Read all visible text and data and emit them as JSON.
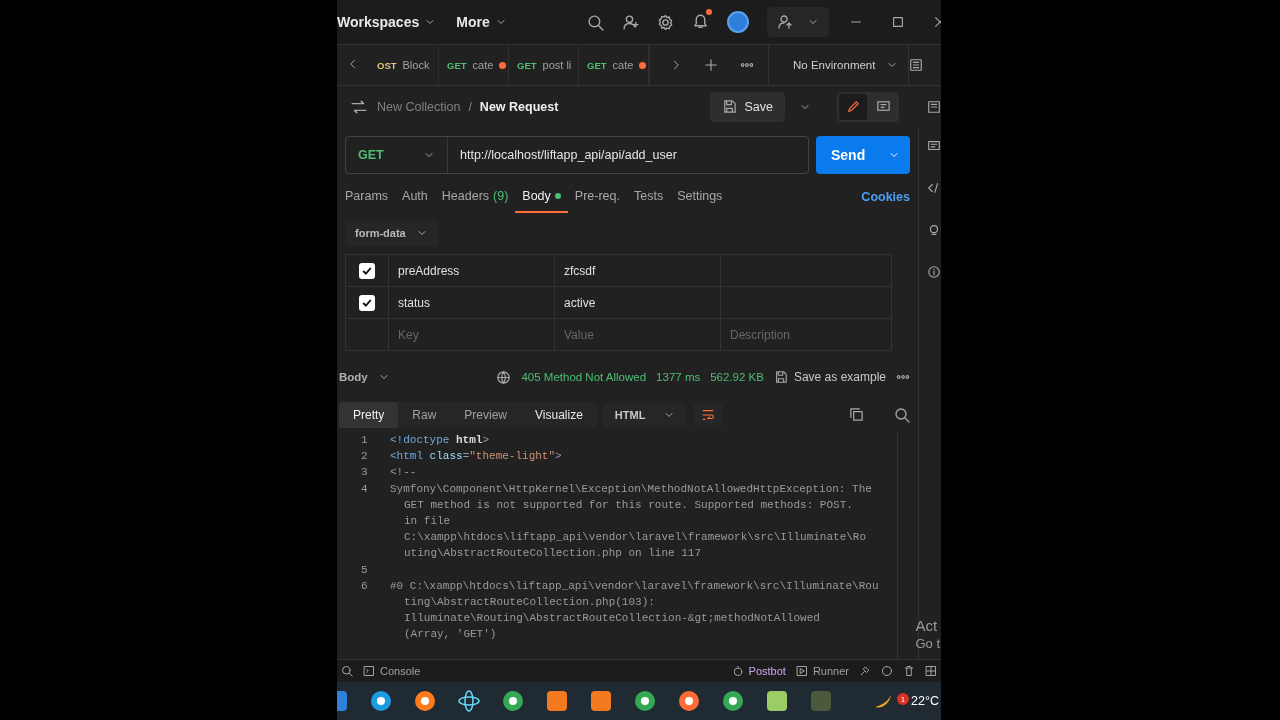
{
  "top_bar": {
    "workspaces": "Workspaces",
    "more": "More"
  },
  "request_tabs": [
    {
      "method": "OST",
      "name": "Block",
      "unsaved": false,
      "selected": false
    },
    {
      "method": "GET",
      "name": "cate",
      "unsaved": true,
      "selected": false
    },
    {
      "method": "GET",
      "name": "post li",
      "unsaved": false,
      "selected": false
    },
    {
      "method": "GET",
      "name": "cate",
      "unsaved": true,
      "selected": false
    }
  ],
  "environment": "No Environment",
  "breadcrumb": {
    "collection": "New Collection",
    "separator": "/",
    "request": "New Request"
  },
  "save_button": "Save",
  "url_bar": {
    "method": "GET",
    "url": "http://localhost/liftapp_api/api/add_user",
    "send": "Send"
  },
  "mode_toggle": [
    {
      "kind": "edit",
      "selected": true
    },
    {
      "kind": "comments",
      "selected": false
    }
  ],
  "section_tabs": [
    {
      "label": "Params",
      "selected": false,
      "dot": false
    },
    {
      "label": "Auth",
      "selected": false,
      "dot": false
    },
    {
      "label": "Headers",
      "count": "(9)",
      "selected": false,
      "dot": false
    },
    {
      "label": "Body",
      "selected": true,
      "dot": true
    },
    {
      "label": "Pre-req.",
      "selected": false,
      "dot": false
    },
    {
      "label": "Tests",
      "selected": false,
      "dot": false
    },
    {
      "label": "Settings",
      "selected": false,
      "dot": false
    }
  ],
  "cookies": "Cookies",
  "body_mode": "form-data",
  "body_table": {
    "rows": [
      {
        "key": "preAddress",
        "value": "zfcsdf",
        "checked": true
      },
      {
        "key": "status",
        "value": "active",
        "checked": true
      }
    ],
    "new_row": [
      {
        "placeholder": "Key"
      },
      {
        "placeholder": "Value"
      },
      {
        "placeholder": "Description"
      }
    ]
  },
  "response_bar": {
    "label": "Body",
    "status": "405 Method Not Allowed",
    "time": "1377 ms",
    "size": "562.92 KB",
    "save_example": "Save as example"
  },
  "response_tabs": [
    {
      "label": "Pretty",
      "selected": true
    },
    {
      "label": "Raw",
      "selected": false
    },
    {
      "label": "Preview",
      "selected": false
    },
    {
      "label": "Visualize",
      "selected": false
    }
  ],
  "format": "HTML",
  "code_lines": [
    {
      "number": "1",
      "tokens": [
        {
          "text": "<!doctype ",
          "kind": "tag"
        },
        {
          "text": "html",
          "kind": "name"
        },
        {
          "text": ">",
          "kind": "punct"
        }
      ]
    },
    {
      "number": "2",
      "tokens": [
        {
          "text": "<html ",
          "kind": "tag"
        },
        {
          "text": "class",
          "kind": "attr"
        },
        {
          "text": "=",
          "kind": "punct"
        },
        {
          "text": "\"theme-light\"",
          "kind": "string"
        },
        {
          "text": ">",
          "kind": "punct"
        }
      ]
    },
    {
      "number": "3",
      "tokens": [
        {
          "text": "<!--",
          "kind": "comment"
        }
      ]
    },
    {
      "number": "4",
      "tokens": [
        {
          "text": "Symfony\\Component\\HttpKernel\\Exception\\MethodNotAllowedHttpException: The",
          "kind": "comment"
        }
      ],
      "continuations": [
        "GET method is not supported for this route. Supported methods: POST.",
        "in file",
        "C:\\xampp\\htdocs\\liftapp_api\\vendor\\laravel\\framework\\src\\Illuminate\\Ro",
        "uting\\AbstractRouteCollection.php on line 117"
      ]
    },
    {
      "number": "5"
    },
    {
      "number": "6",
      "tokens": [
        {
          "text": "#0 C:\\xampp\\htdocs\\liftapp_api\\vendor\\laravel\\framework\\src\\Illuminate\\Rou",
          "kind": "comment"
        }
      ],
      "continuations": [
        "ting\\AbstractRouteCollection.php(103):",
        "Illuminate\\Routing\\AbstractRouteCollection-&gt;methodNotAllowed",
        "(Array, 'GET')"
      ]
    }
  ],
  "os_notice": [
    "Act",
    "Go t"
  ],
  "status_bar": {
    "console": "Console",
    "postbot": "Postbot",
    "runner": "Runner"
  },
  "taskbar": {
    "apps": [
      {
        "color": "#2f80d8",
        "kind": "square"
      },
      {
        "color": "#1e9be0",
        "kind": "circle"
      },
      {
        "color": "#ff7a1a",
        "kind": "circle"
      },
      {
        "color": "#61dafb",
        "kind": "ring"
      },
      {
        "color": "#34a853",
        "kind": "circle"
      },
      {
        "color": "#f47a20",
        "kind": "square"
      },
      {
        "color": "#f47a20",
        "kind": "square"
      },
      {
        "color": "#34a853",
        "kind": "circle"
      },
      {
        "color": "#ff6c37",
        "kind": "circle"
      },
      {
        "color": "#34a853",
        "kind": "circle"
      },
      {
        "color": "#9ccc65",
        "kind": "square"
      },
      {
        "color": "#4a5a3a",
        "kind": "square"
      }
    ],
    "weather_badge": "1",
    "temperature": "22°C"
  }
}
